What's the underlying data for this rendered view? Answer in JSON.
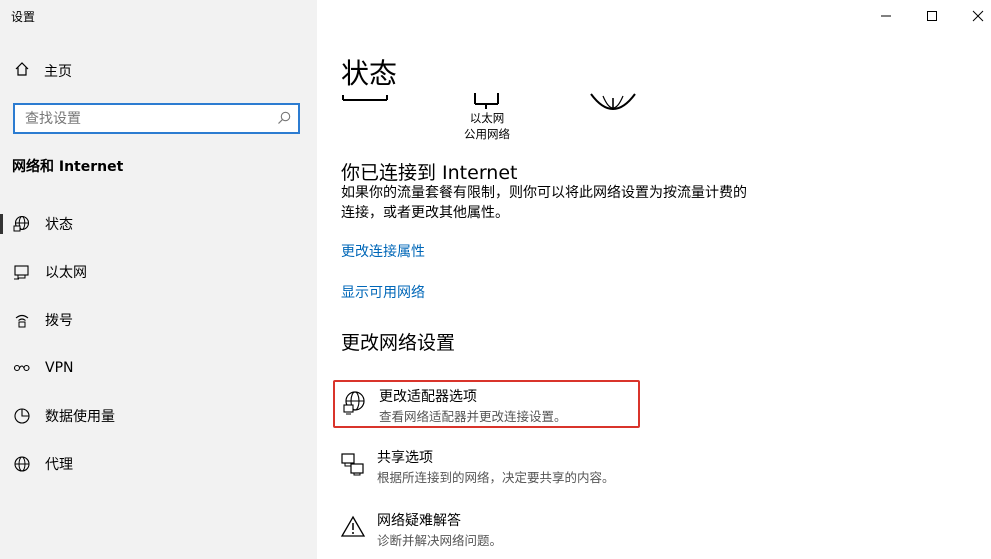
{
  "window": {
    "title": "设置"
  },
  "sidebar": {
    "home_label": "主页",
    "search_placeholder": "查找设置",
    "section_title": "网络和 Internet",
    "items": [
      {
        "label": "状态",
        "icon": "status-globe-icon",
        "active": true
      },
      {
        "label": "以太网",
        "icon": "ethernet-icon"
      },
      {
        "label": "拨号",
        "icon": "dialup-icon"
      },
      {
        "label": "VPN",
        "icon": "vpn-icon"
      },
      {
        "label": "数据使用量",
        "icon": "data-usage-icon"
      },
      {
        "label": "代理",
        "icon": "proxy-globe-icon"
      }
    ]
  },
  "main": {
    "page_title": "状态",
    "network": {
      "name": "以太网",
      "type": "公用网络"
    },
    "connected_heading": "你已连接到 Internet",
    "connected_desc": "如果你的流量套餐有限制，则你可以将此网络设置为按流量计费的连接，或者更改其他属性。",
    "links": {
      "change_properties": "更改连接属性",
      "show_networks": "显示可用网络"
    },
    "change_settings_heading": "更改网络设置",
    "options": [
      {
        "title": "更改适配器选项",
        "subtitle": "查看网络适配器并更改连接设置。",
        "icon": "adapter-globe-icon",
        "highlighted": true
      },
      {
        "title": "共享选项",
        "subtitle": "根据所连接到的网络，决定要共享的内容。",
        "icon": "sharing-icon"
      },
      {
        "title": "网络疑难解答",
        "subtitle": "诊断并解决网络问题。",
        "icon": "warning-icon"
      }
    ]
  },
  "colors": {
    "accent": "#0067b8",
    "search_border": "#2c7cd1",
    "highlight": "#d9342b"
  }
}
